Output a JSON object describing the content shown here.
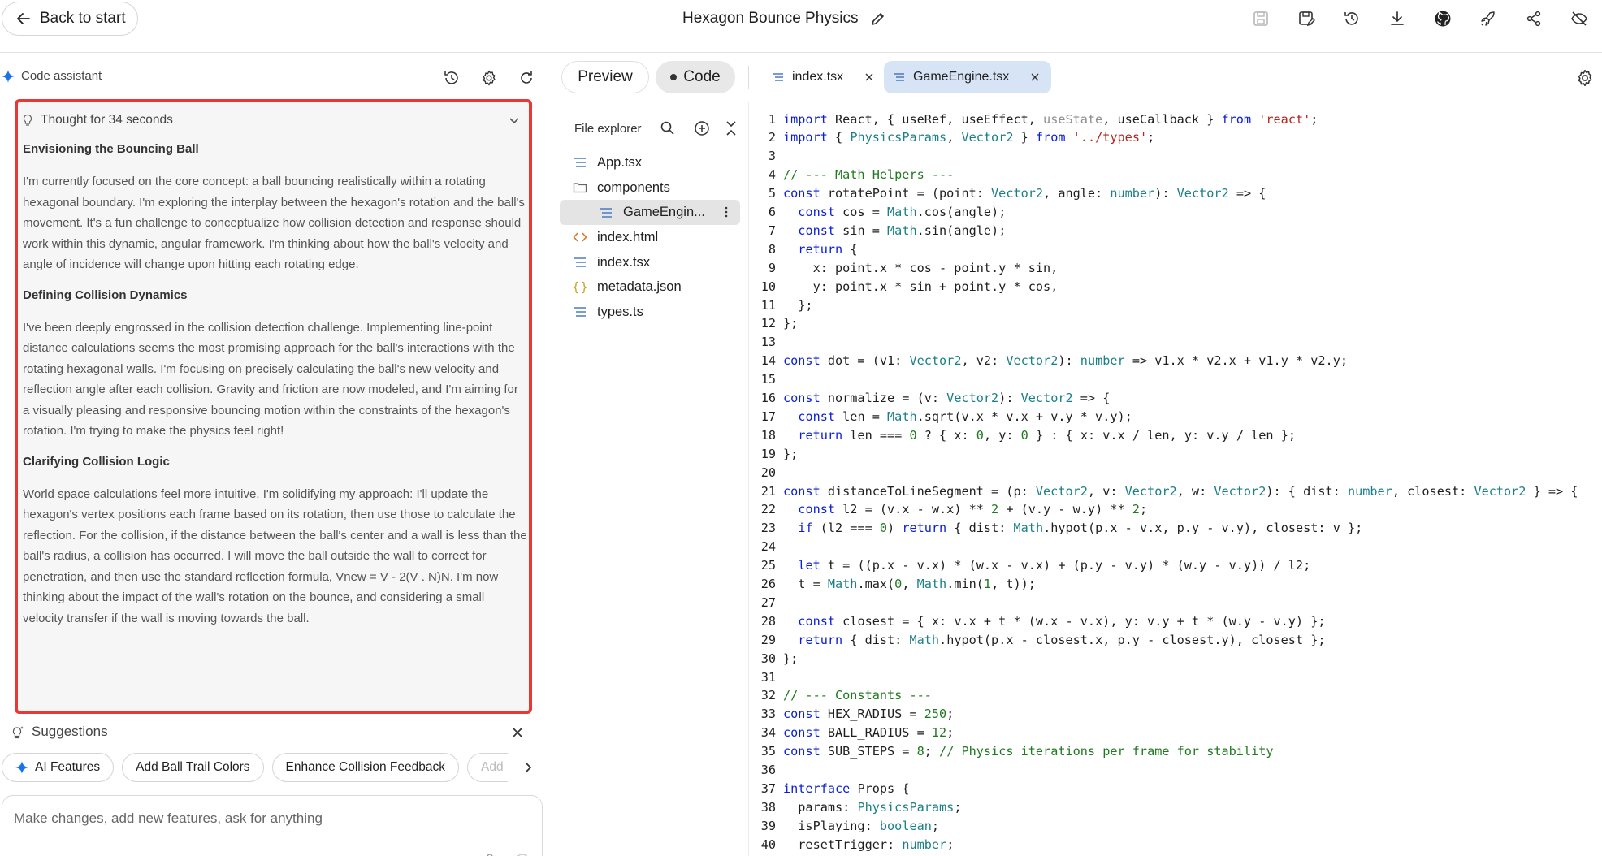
{
  "header": {
    "back_label": "Back to start",
    "title": "Hexagon Bounce Physics",
    "icons": [
      "save-icon",
      "save-as-icon",
      "history-icon",
      "download-icon",
      "github-icon",
      "deploy-icon",
      "share-icon",
      "hide-icon"
    ]
  },
  "assistant": {
    "title": "Code assistant",
    "thought_label": "Thought for 34 seconds",
    "sections": [
      {
        "heading": "Envisioning the Bouncing Ball",
        "text": "I'm currently focused on the core concept: a ball bouncing realistically within a rotating hexagonal boundary. I'm exploring the interplay between the hexagon's rotation and the ball's movement. It's a fun challenge to conceptualize how collision detection and response should work within this dynamic, angular framework. I'm thinking about how the ball's velocity and angle of incidence will change upon hitting each rotating edge."
      },
      {
        "heading": "Defining Collision Dynamics",
        "text": "I've been deeply engrossed in the collision detection challenge. Implementing line-point distance calculations seems the most promising approach for the ball's interactions with the rotating hexagonal walls. I'm focusing on precisely calculating the ball's new velocity and reflection angle after each collision. Gravity and friction are now modeled, and I'm aiming for a visually pleasing and responsive bouncing motion within the constraints of the hexagon's rotation. I'm trying to make the physics feel right!"
      },
      {
        "heading": "Clarifying Collision Logic",
        "text": "World space calculations feel more intuitive. I'm solidifying my approach: I'll update the hexagon's vertex positions each frame based on its rotation, then use those to calculate the reflection. For the collision, if the distance between the ball's center and a wall is less than the ball's radius, a collision has occurred. I will move the ball outside the wall to correct for penetration, and then use the standard reflection formula, Vnew = V - 2(V . N)N. I'm now thinking about the impact of the wall's rotation on the bounce, and considering a small velocity transfer if the wall is moving towards the ball."
      }
    ],
    "suggestions_label": "Suggestions",
    "chips": [
      "AI Features",
      "Add Ball Trail Colors",
      "Enhance Collision Feedback",
      "Add"
    ],
    "prompt_placeholder": "Make changes, add new features, ask for anything"
  },
  "editor": {
    "view_preview": "Preview",
    "view_code": "Code",
    "tabs": [
      {
        "label": "index.tsx"
      },
      {
        "label": "GameEngine.tsx"
      }
    ],
    "explorer_title": "File explorer",
    "files": [
      {
        "name": "App.tsx",
        "icon": "tsx-file-icon"
      },
      {
        "name": "components",
        "icon": "folder-icon"
      },
      {
        "name": "GameEngin...",
        "icon": "tsx-file-icon"
      },
      {
        "name": "index.html",
        "icon": "html-file-icon"
      },
      {
        "name": "index.tsx",
        "icon": "tsx-file-icon"
      },
      {
        "name": "metadata.json",
        "icon": "json-file-icon"
      },
      {
        "name": "types.ts",
        "icon": "tsx-file-icon"
      }
    ],
    "code_lines": [
      "import React, { useRef, useEffect, useState, useCallback } from 'react';",
      "import { PhysicsParams, Vector2 } from '../types';",
      "",
      "// --- Math Helpers ---",
      "const rotatePoint = (point: Vector2, angle: number): Vector2 => {",
      "  const cos = Math.cos(angle);",
      "  const sin = Math.sin(angle);",
      "  return {",
      "    x: point.x * cos - point.y * sin,",
      "    y: point.x * sin + point.y * cos,",
      "  };",
      "};",
      "",
      "const dot = (v1: Vector2, v2: Vector2): number => v1.x * v2.x + v1.y * v2.y;",
      "",
      "const normalize = (v: Vector2): Vector2 => {",
      "  const len = Math.sqrt(v.x * v.x + v.y * v.y);",
      "  return len === 0 ? { x: 0, y: 0 } : { x: v.x / len, y: v.y / len };",
      "};",
      "",
      "const distanceToLineSegment = (p: Vector2, v: Vector2, w: Vector2): { dist: number, closest: Vector2 } => {",
      "  const l2 = (v.x - w.x) ** 2 + (v.y - w.y) ** 2;",
      "  if (l2 === 0) return { dist: Math.hypot(p.x - v.x, p.y - v.y), closest: v };",
      "",
      "  let t = ((p.x - v.x) * (w.x - v.x) + (p.y - v.y) * (w.y - v.y)) / l2;",
      "  t = Math.max(0, Math.min(1, t));",
      "",
      "  const closest = { x: v.x + t * (w.x - v.x), y: v.y + t * (w.y - v.y) };",
      "  return { dist: Math.hypot(p.x - closest.x, p.y - closest.y), closest };",
      "};",
      "",
      "// --- Constants ---",
      "const HEX_RADIUS = 250;",
      "const BALL_RADIUS = 12;",
      "const SUB_STEPS = 8; // Physics iterations per frame for stability",
      "",
      "interface Props {",
      "  params: PhysicsParams;",
      "  isPlaying: boolean;",
      "  resetTrigger: number;"
    ]
  }
}
